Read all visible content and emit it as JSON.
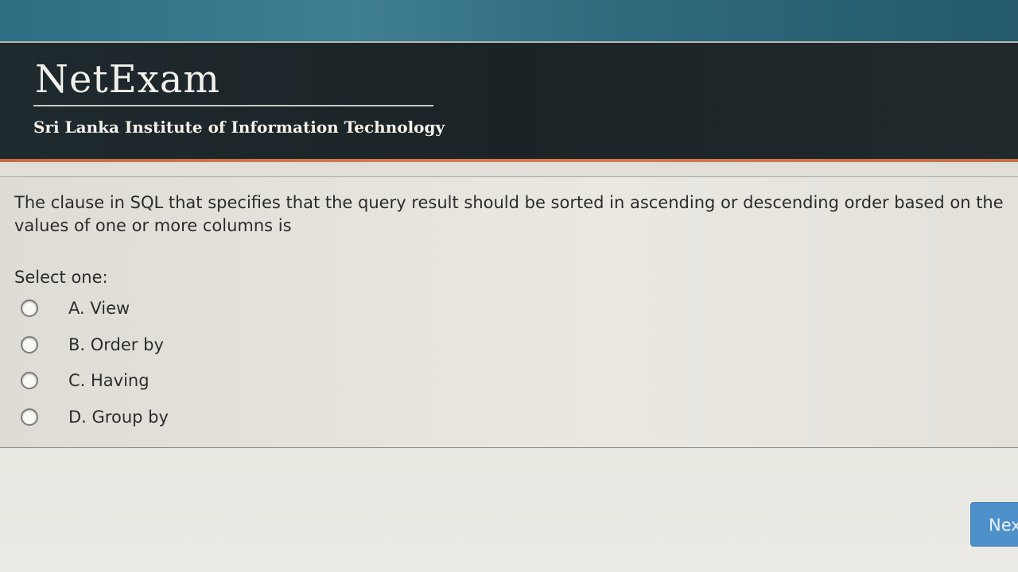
{
  "header": {
    "brand": "NetExam",
    "institute": "Sri Lanka Institute of Information Technology"
  },
  "question": {
    "text": "The clause in SQL that specifies that the query result should be sorted in ascending or descending order based on the values of one or more columns is",
    "select_label": "Select one:",
    "options": [
      {
        "label": "A. View",
        "selected": false
      },
      {
        "label": "B. Order by",
        "selected": false
      },
      {
        "label": "C. Having",
        "selected": false
      },
      {
        "label": "D. Group by",
        "selected": false
      }
    ]
  },
  "footer": {
    "next_label": "Nex"
  }
}
